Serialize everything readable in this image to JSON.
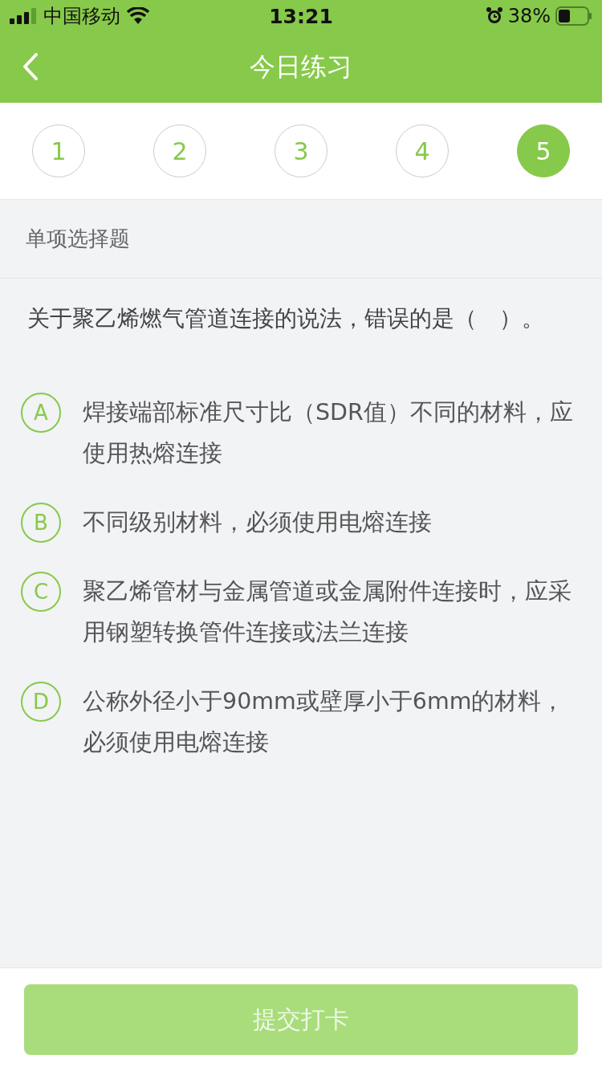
{
  "status_bar": {
    "carrier": "中国移动",
    "time": "13:21",
    "battery": "38%"
  },
  "header": {
    "title": "今日练习"
  },
  "questions": [
    {
      "label": "1",
      "selected": false
    },
    {
      "label": "2",
      "selected": false
    },
    {
      "label": "3",
      "selected": false
    },
    {
      "label": "4",
      "selected": false
    },
    {
      "label": "5",
      "selected": true
    }
  ],
  "section": {
    "title": "单项选择题"
  },
  "question": {
    "text": "关于聚乙烯燃气管道连接的说法，错误的是（　）。"
  },
  "options": [
    {
      "letter": "A",
      "text": "焊接端部标准尺寸比（SDR值）不同的材料，应使用热熔连接",
      "selected": false
    },
    {
      "letter": "B",
      "text": "不同级别材料，必须使用电熔连接",
      "selected": false
    },
    {
      "letter": "C",
      "text": "聚乙烯管材与金属管道或金属附件连接时，应采用钢塑转换管件连接或法兰连接",
      "selected": false
    },
    {
      "letter": "D",
      "text": "公称外径小于90mm或壁厚小于6mm的材料，必须使用电熔连接",
      "selected": false
    }
  ],
  "submit": {
    "label": "提交打卡",
    "disabled": true
  }
}
